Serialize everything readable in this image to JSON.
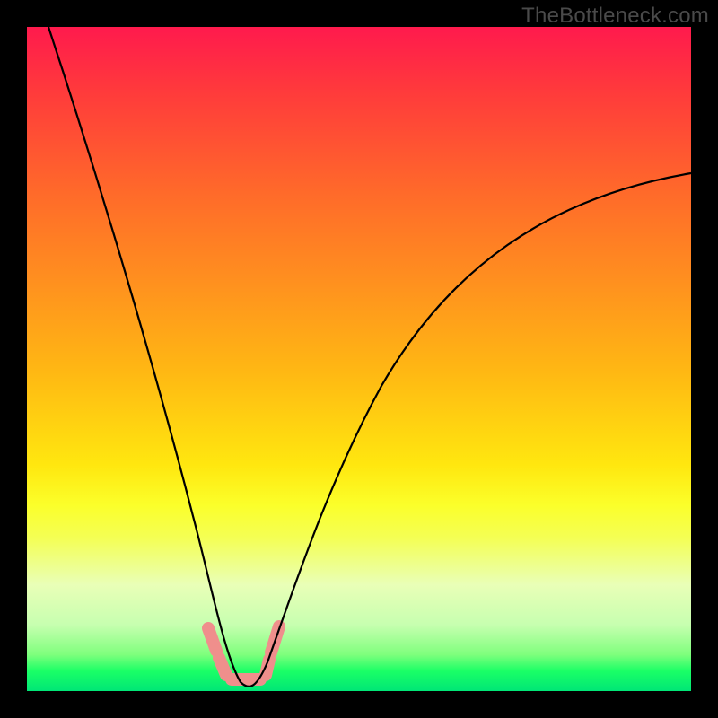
{
  "watermark": "TheBottleneck.com",
  "chart_data": {
    "type": "line",
    "title": "",
    "xlabel": "",
    "ylabel": "",
    "xlim": [
      0,
      100
    ],
    "ylim": [
      0,
      100
    ],
    "grid": false,
    "legend": false,
    "series": [
      {
        "name": "bottleneck-curve",
        "x": [
          3,
          7,
          12,
          17,
          22,
          26,
          29,
          31,
          33,
          35,
          37,
          40,
          44,
          50,
          58,
          68,
          80,
          100
        ],
        "values": [
          100,
          83,
          65,
          47,
          30,
          16,
          7,
          3,
          1,
          1,
          3,
          10,
          23,
          40,
          56,
          67,
          74,
          78
        ]
      }
    ],
    "highlight": {
      "name": "optimal-zone",
      "x_range": [
        26,
        38
      ],
      "y_range": [
        0,
        9
      ]
    },
    "background_gradient": {
      "top": "#ff1a4d",
      "mid": "#ffe70f",
      "bottom": "#00e676"
    }
  }
}
